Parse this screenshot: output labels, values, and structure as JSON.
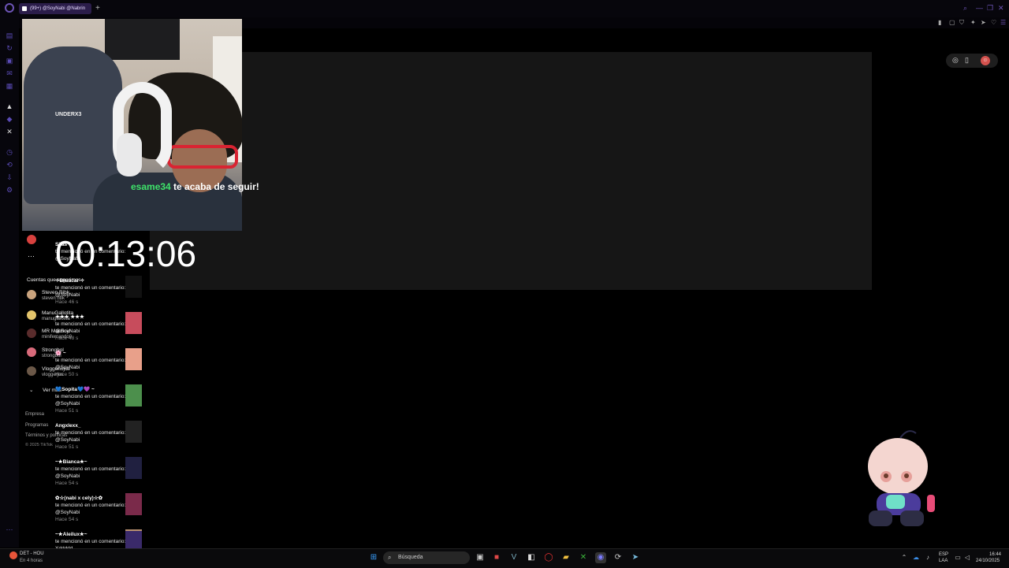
{
  "browser": {
    "tab_title": "(99+) @SoyNabi @Nabrin",
    "new_tab_symbol": "+",
    "window_controls": [
      "⌕",
      "—",
      "❐",
      "✕"
    ]
  },
  "overlay": {
    "follow_user": "esame34",
    "follow_text": " te acaba de seguir!",
    "timer": "00:13:06"
  },
  "webcam": {
    "chair_brand": "UNDERX3"
  },
  "sidebar": {
    "suggested_title": "Cuentas que sugerimos",
    "accounts": [
      {
        "name": "Steven Ribk",
        "handle": "steven ribk"
      },
      {
        "name": "ManuGallotita",
        "handle": "manugallotita"
      },
      {
        "name": "MR Mauricio",
        "handle": "minifernando0"
      },
      {
        "name": "Strongbol",
        "handle": "strongbol"
      },
      {
        "name": "Vloggeriojos",
        "handle": "vloggerjos"
      }
    ],
    "ver_mas": "Ver más",
    "footer": [
      "Empresa",
      "Programas",
      "Términos y políticas",
      "© 2025 TikTok"
    ]
  },
  "notifications": [
    {
      "name": "Silas",
      "text": "te mencionó en un comentario: @SoyNabi",
      "ago": ""
    },
    {
      "name": "✧Bruacar ✧",
      "text": "te mencionó en un comentario: @SoyNabi",
      "ago": "Hace 46 s"
    },
    {
      "name": "★★★ ★★★",
      "text": "te mencionó en un comentario: @SoyNabi",
      "ago": "Hace 48 s"
    },
    {
      "name": "🌸 ~",
      "text": "te mencionó en un comentario: @SoyNabi",
      "ago": "Hace 50 s"
    },
    {
      "name": "💙Sopita💙💜 ~",
      "text": "te mencionó en un comentario: @SoyNabi",
      "ago": "Hace 51 s"
    },
    {
      "name": "Angxlexx_",
      "text": "te mencionó en un comentario: @SoyNabi",
      "ago": "Hace 51 s"
    },
    {
      "name": "~★Bianca★~",
      "text": "te mencionó en un comentario: @SoyNabi",
      "ago": "Hace 54 s"
    },
    {
      "name": "✿☆(nabi x cely)☆✿",
      "text": "te mencionó en un comentario: @SoyNabi",
      "ago": "Hace 54 s"
    },
    {
      "name": "~★Aleilux★~",
      "text": "te mencionó en un comentario: Xddddd",
      "ago": ""
    }
  ],
  "taskbar": {
    "weather_temp": "DET - HOU",
    "weather_sub": "En 4 horas",
    "search_placeholder": "Búsqueda",
    "lang_top": "ESP",
    "lang_bottom": "LAA",
    "time": "16:44",
    "date": "24/10/2025"
  },
  "colors": {
    "accent": "#6e55b8",
    "follow_user": "#3ee36a"
  }
}
